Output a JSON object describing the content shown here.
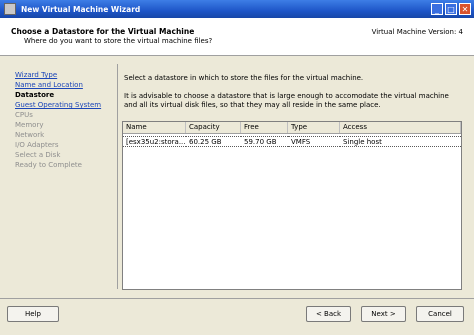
{
  "window": {
    "title": "New Virtual Machine Wizard",
    "minimize_glyph": "_",
    "maximize_glyph": "□",
    "close_glyph": "✕"
  },
  "header": {
    "title": "Choose a Datastore for the Virtual Machine",
    "subtitle": "Where do you want to store the virtual machine files?",
    "version": "Virtual Machine Version: 4"
  },
  "nav": {
    "items": [
      {
        "label": "Wizard Type",
        "state": "link"
      },
      {
        "label": "Name and Location",
        "state": "link"
      },
      {
        "label": "Datastore",
        "state": "current"
      },
      {
        "label": "Guest Operating System",
        "state": "link"
      },
      {
        "label": "CPUs",
        "state": "disabled"
      },
      {
        "label": "Memory",
        "state": "disabled"
      },
      {
        "label": "Network",
        "state": "disabled"
      },
      {
        "label": "I/O Adapters",
        "state": "disabled"
      },
      {
        "label": "Select a Disk",
        "state": "disabled"
      },
      {
        "label": "Ready to Complete",
        "state": "disabled"
      }
    ]
  },
  "content": {
    "intro": "Select a datastore in which to store the files for the virtual machine.",
    "advice": "It is advisable to choose a datastore that is large enough to accomodate the virtual machine and all its virtual disk files, so that they may all reside in the same place."
  },
  "table": {
    "columns": [
      "Name",
      "Capacity",
      "Free",
      "Type",
      "Access"
    ],
    "rows": [
      [
        "[esx35u2:stora...",
        "60.25 GB",
        "59.70 GB",
        "VMFS",
        "Single host"
      ]
    ]
  },
  "footer": {
    "help": "Help",
    "back": "< Back",
    "next": "Next >",
    "cancel": "Cancel"
  }
}
